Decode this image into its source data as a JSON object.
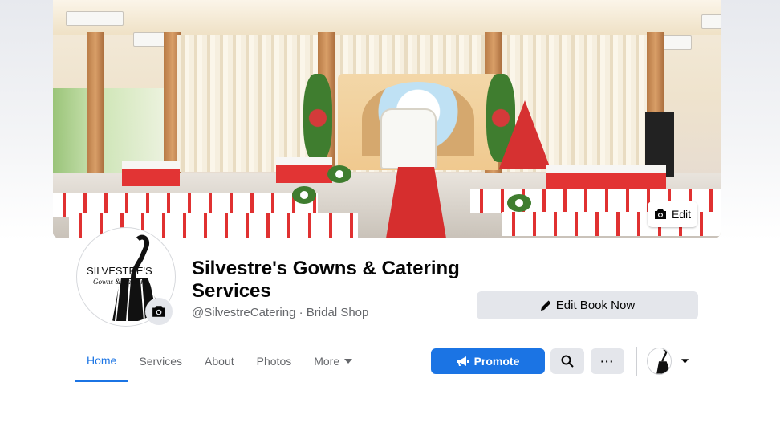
{
  "cover": {
    "edit_label": "Edit"
  },
  "avatar": {
    "logo_line1": "SILVESTRE'S",
    "logo_line2": "Gowns & Catering"
  },
  "page": {
    "title": "Silvestre's Gowns & Catering Services",
    "username": "@SilvestreCatering",
    "separator": "·",
    "category": "Bridal Shop"
  },
  "actions": {
    "book_label": "Edit Book Now"
  },
  "nav": {
    "tabs": [
      {
        "label": "Home",
        "active": true
      },
      {
        "label": "Services"
      },
      {
        "label": "About"
      },
      {
        "label": "Photos"
      },
      {
        "label": "More"
      }
    ]
  },
  "toolbar": {
    "promote_label": "Promote",
    "more_label": "···"
  },
  "colors": {
    "accent": "#1b74e4",
    "button_gray": "#e4e6eb",
    "text_primary": "#050505",
    "text_secondary": "#65676b"
  }
}
